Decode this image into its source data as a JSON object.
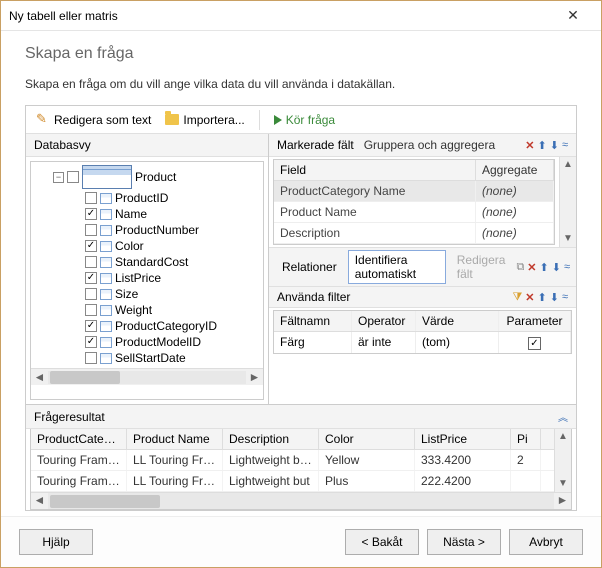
{
  "window": {
    "title": "Ny tabell eller matris"
  },
  "header": {
    "heading": "Skapa en fråga",
    "desc": "Skapa en fråga om du vill ange vilka data du vill använda i datakällan."
  },
  "toolbar": {
    "edit_as_text": "Redigera som text",
    "import": "Importera...",
    "run_query": "Kör fråga"
  },
  "dbview": {
    "title": "Databasvy",
    "root": "Product",
    "columns": [
      {
        "name": "ProductID",
        "checked": false
      },
      {
        "name": "Name",
        "checked": true
      },
      {
        "name": "ProductNumber",
        "checked": false
      },
      {
        "name": "Color",
        "checked": true
      },
      {
        "name": "StandardCost",
        "checked": false
      },
      {
        "name": "ListPrice",
        "checked": true
      },
      {
        "name": "Size",
        "checked": false
      },
      {
        "name": "Weight",
        "checked": false
      },
      {
        "name": "ProductCategoryID",
        "checked": true
      },
      {
        "name": "ProductModelID",
        "checked": true
      },
      {
        "name": "SellStartDate",
        "checked": false
      }
    ]
  },
  "selected": {
    "title": "Markerade fält",
    "group_label": "Gruppera och aggregera",
    "col_field": "Field",
    "col_agg": "Aggregate",
    "rows": [
      {
        "field": "ProductCategory Name",
        "agg": "(none)"
      },
      {
        "field": "Product Name",
        "agg": "(none)"
      },
      {
        "field": "Description",
        "agg": "(none)"
      }
    ]
  },
  "relations": {
    "label": "Relationer",
    "auto": "Identifiera automatiskt",
    "edit": "Redigera fält"
  },
  "filters": {
    "title": "Använda filter",
    "col_field": "Fältnamn",
    "col_op": "Operator",
    "col_val": "Värde",
    "col_param": "Parameter",
    "rows": [
      {
        "field": "Färg",
        "op": "är inte",
        "val": "(tom)",
        "param": true
      }
    ]
  },
  "results": {
    "title": "Frågeresultat",
    "cols": [
      "ProductCategor...",
      "Product Name",
      "Description",
      "Color",
      "ListPrice",
      "Pi"
    ],
    "rows": [
      [
        "Touring Frames",
        "LL Touring Fram...",
        "Lightweight but...",
        "Yellow",
        "333.4200",
        "2"
      ],
      [
        "Touring Frames",
        "LL Touring Fram",
        "Lightweight but",
        "Plus",
        "222.4200",
        ""
      ]
    ]
  },
  "footer": {
    "help": "Hjälp",
    "back": "< Bakåt",
    "next": "Nästa >",
    "cancel": "Avbryt"
  }
}
